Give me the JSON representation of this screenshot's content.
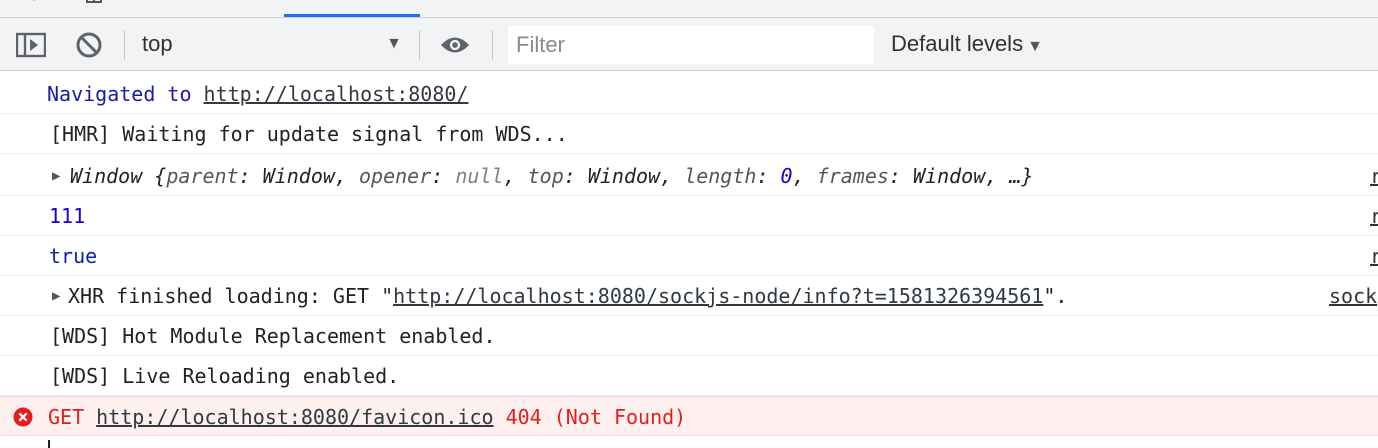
{
  "toolbar": {
    "context": "top",
    "filter_placeholder": "Filter",
    "levels": "Default levels"
  },
  "console": {
    "nav": {
      "prefix": "Navigated to",
      "url": "http://localhost:8080/"
    },
    "hmr": "[HMR] Waiting for update signal from WDS...",
    "window_obj": {
      "open": "Window {",
      "k1": "parent",
      "v1": "Window",
      "k2": "opener",
      "v2": "null",
      "k3": "top",
      "v3": "Window",
      "k4": "length",
      "v4": "0",
      "k5": "frames",
      "v5": "Window",
      "close": "…}",
      "source": "r"
    },
    "num_value": "111",
    "num_source": "r",
    "bool_value": "true",
    "bool_source": "r",
    "xhr": {
      "prefix": "XHR finished loading: GET \"",
      "url": "http://localhost:8080/sockjs-node/info?t=1581326394561",
      "suffix": "\".",
      "source": "sock"
    },
    "wds1": "[WDS] Hot Module Replacement enabled.",
    "wds2": "[WDS] Live Reloading enabled.",
    "error": {
      "method": "GET",
      "url": "http://localhost:8080/favicon.ico",
      "status": "404 (Not Found)"
    }
  },
  "colors": {
    "accent": "#1a73e8",
    "error_text": "#e41e1e",
    "error_bg": "#fff0f0",
    "number": "#1c00cf",
    "navigated": "#1a1aa6"
  }
}
